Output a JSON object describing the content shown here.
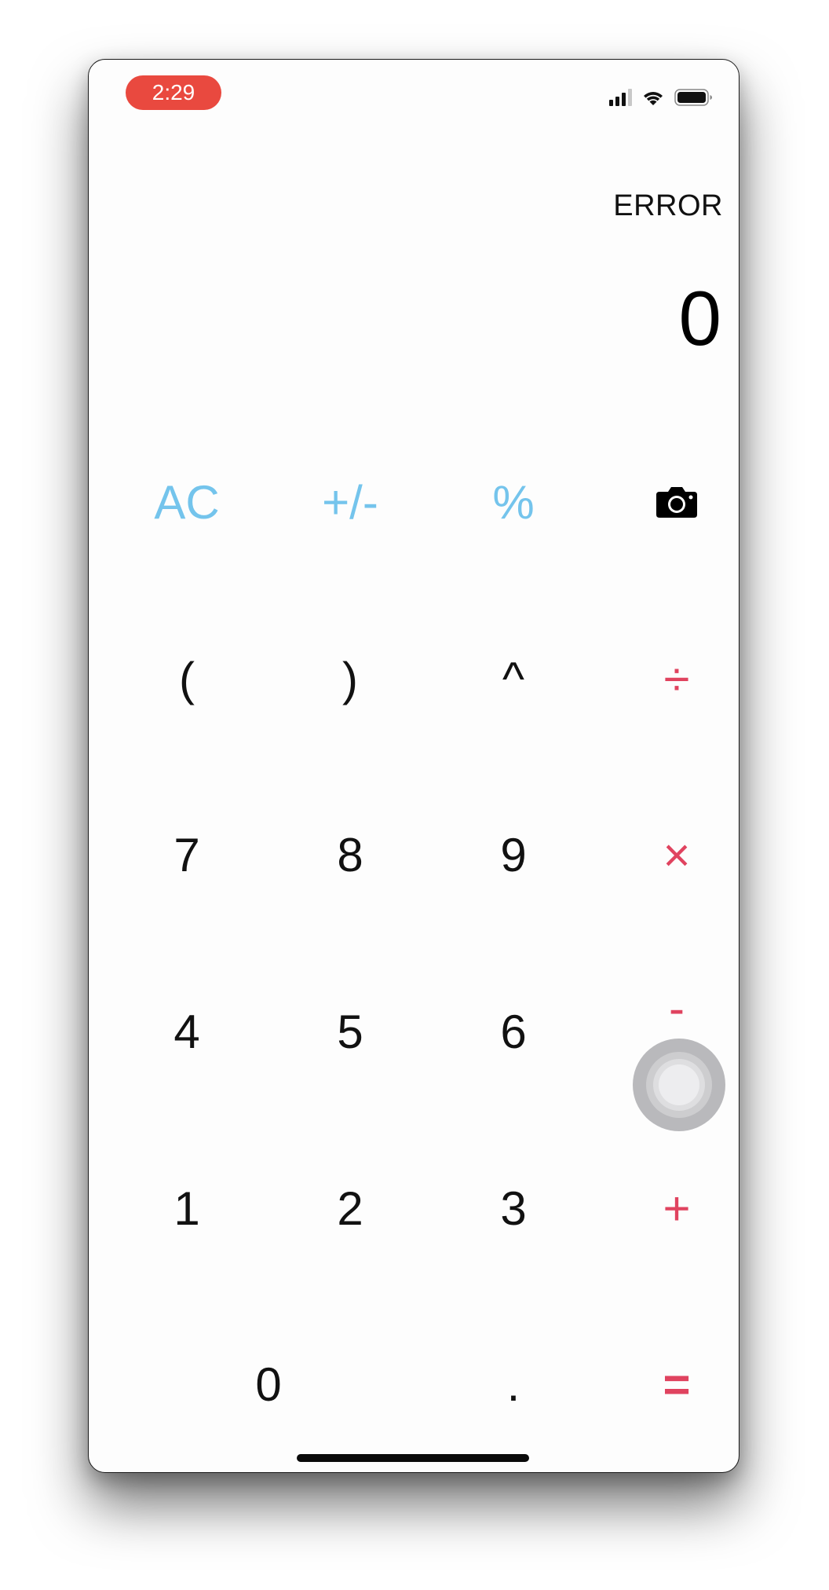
{
  "status_bar": {
    "time": "2:29",
    "icons": [
      "cellular-signal-icon",
      "wifi-icon",
      "battery-icon"
    ]
  },
  "display": {
    "expression": "ERROR",
    "result": "0"
  },
  "keypad": {
    "row1": [
      "AC",
      "+/-",
      "%"
    ],
    "row1_icon": "camera-icon",
    "row2": [
      "(",
      ")",
      "^",
      "÷"
    ],
    "row3": [
      "7",
      "8",
      "9",
      "×"
    ],
    "row4": [
      "4",
      "5",
      "6",
      "-"
    ],
    "row5": [
      "1",
      "2",
      "3",
      "+"
    ],
    "row6": [
      "0",
      ".",
      "="
    ]
  },
  "colors": {
    "function_keys": "#74c4ec",
    "operator_keys": "#e0435f",
    "digits": "#111111",
    "time_pill": "#e9493f"
  },
  "overlay": "assistive-touch-button"
}
